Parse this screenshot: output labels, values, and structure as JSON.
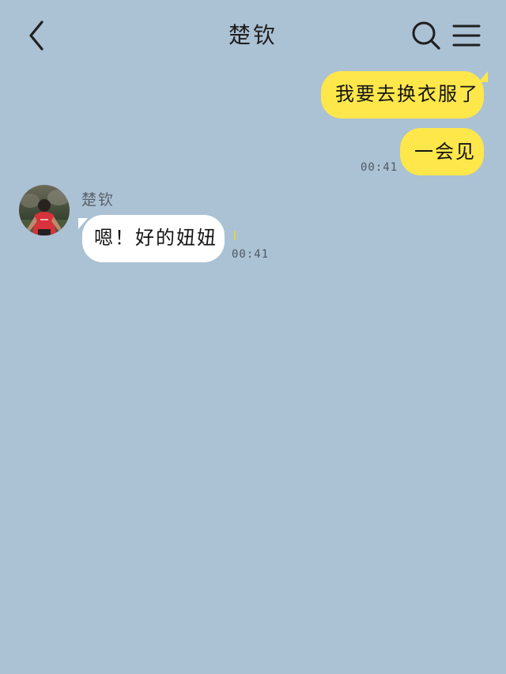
{
  "header": {
    "title": "楚钦",
    "back_icon": "chevron-left-icon",
    "search_icon": "search-icon",
    "menu_icon": "menu-icon"
  },
  "messages": [
    {
      "sender": "self",
      "text": "我要去换衣服了"
    },
    {
      "sender": "self",
      "text": "一会见",
      "time": "00:41"
    },
    {
      "sender": "other",
      "sender_name": "楚钦",
      "text": "嗯！好的妞妞",
      "time": "00:41"
    }
  ],
  "colors": {
    "background": "#abc1d4",
    "self_bubble": "#fde74a",
    "other_bubble": "#ffffff",
    "time_text": "#4e5963"
  }
}
